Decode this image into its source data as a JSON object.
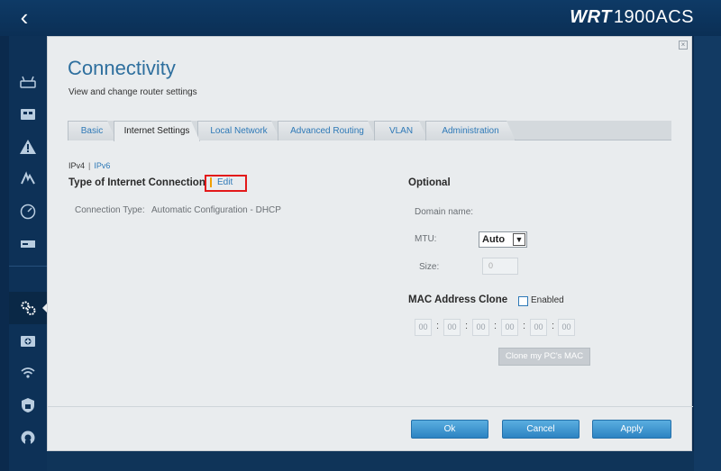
{
  "header": {
    "back_label": "‹",
    "brand_prefix": "WRT",
    "brand_model": "1900ACS"
  },
  "modal": {
    "title": "Connectivity",
    "subtitle": "View and change router settings",
    "close_label": "×"
  },
  "tabs": [
    {
      "label": "Basic"
    },
    {
      "label": "Internet Settings"
    },
    {
      "label": "Local Network"
    },
    {
      "label": "Advanced Routing"
    },
    {
      "label": "VLAN"
    },
    {
      "label": "Administration"
    }
  ],
  "ip_version": {
    "ipv4": "IPv4",
    "separator": "|",
    "ipv6": "IPv6"
  },
  "internet_connection": {
    "title": "Type of Internet Connection",
    "edit_label": "Edit",
    "connection_type_label": "Connection Type:",
    "connection_type_value": "Automatic Configuration - DHCP"
  },
  "optional": {
    "title": "Optional",
    "domain_name_label": "Domain name:",
    "mtu_label": "MTU:",
    "mtu_value": "Auto",
    "size_label": "Size:",
    "size_value": "0"
  },
  "mac_clone": {
    "title": "MAC Address Clone",
    "enabled_label": "Enabled",
    "octets": [
      "00",
      "00",
      "00",
      "00",
      "00",
      "00"
    ],
    "clone_button_label": "Clone my PC's MAC"
  },
  "footer": {
    "ok_label": "Ok",
    "cancel_label": "Cancel",
    "apply_label": "Apply"
  }
}
